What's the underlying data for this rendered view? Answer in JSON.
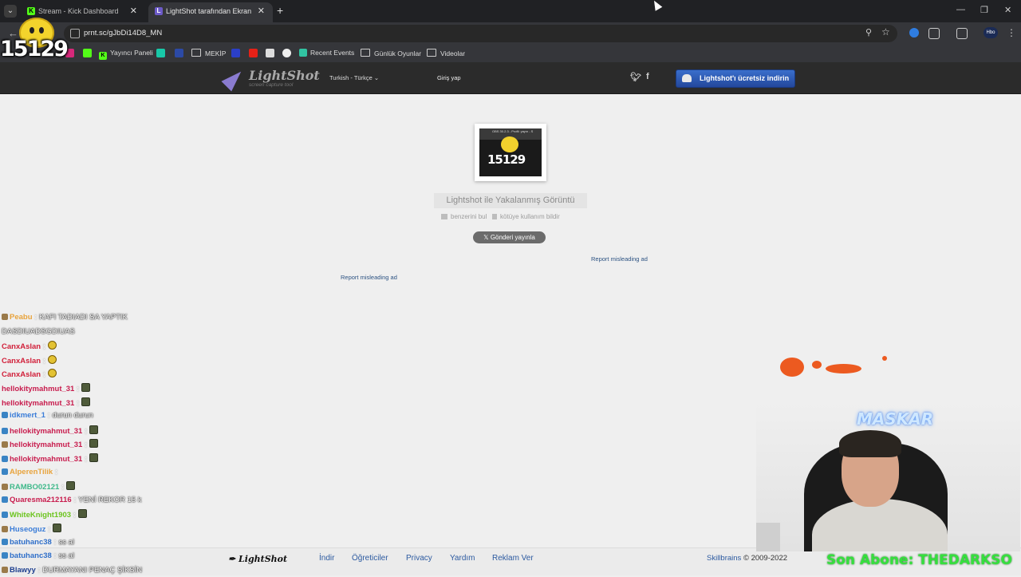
{
  "browser": {
    "tabs": [
      {
        "title": "Stream - Kick Dashboard",
        "active": false,
        "favicon": "kick-icon"
      },
      {
        "title": "LightShot tarafından Ekran Gör",
        "active": true,
        "favicon": "lightshot-icon"
      }
    ],
    "url": "prnt.sc/gJbDi14D8_MN",
    "bookmarks": [
      "Yayıncı Paneli",
      "MEKİP",
      "Recent Events",
      "Günlük Oyunlar",
      "Videolar"
    ],
    "profile_label": "Hbo"
  },
  "lightshot": {
    "logo": {
      "name": "LightShot",
      "tagline": "screen capture tool"
    },
    "language": "Turkish - Türkçe",
    "login": "Giriş yap",
    "social": {
      "twitter": "t",
      "facebook": "f"
    },
    "download_button": "Lightshot'ı ücretsiz indirin",
    "thumbnail": {
      "header_text": "OBS 30.2.3 - Profil: yayın - S",
      "number": "15129"
    },
    "capture_title": "Lightshot ile Yakalanmış Görüntü",
    "find_similar": "benzerini bul",
    "report_abuse": "kötüye kullanım bildir",
    "tweet_button": "Gönderi yayınla",
    "report_ad_1": "Report misleading ad",
    "report_ad_2": "Report misleading ad",
    "footer": {
      "logo": "LightShot",
      "links": [
        "İndir",
        "Öğreticiler",
        "Privacy",
        "Yardım",
        "Reklam Ver"
      ],
      "company": "Skillbrains",
      "copyright": "© 2009-2022"
    }
  },
  "overlay": {
    "counter": "15129",
    "webcam_name": "MASKAR",
    "last_subscriber": "Son Abone: THEDARKSO",
    "chat": [
      {
        "user": "Peabu",
        "text": "KAFI TADIADI SA YAPTIK",
        "color": "#e8a33c"
      },
      {
        "user": "",
        "text": "DASDIUADSGDIUAS",
        "color": "#ffffff"
      },
      {
        "user": "CanxAslan",
        "text": "",
        "color": "#d1203a",
        "emote": "face"
      },
      {
        "user": "CanxAslan",
        "text": "",
        "color": "#d1203a",
        "emote": "face"
      },
      {
        "user": "CanxAslan",
        "text": "",
        "color": "#d1203a",
        "emote": "face"
      },
      {
        "user": "hellokitymahmut_31",
        "text": "",
        "color": "#c81d4e",
        "emote": "tank"
      },
      {
        "user": "hellokitymahmut_31",
        "text": "",
        "color": "#c81d4e",
        "emote": "tank"
      },
      {
        "user": "idkmert_1",
        "text": "durun durun",
        "color": "#3b7dd8"
      },
      {
        "user": "hellokitymahmut_31",
        "text": "",
        "color": "#c81d4e",
        "emote": "tank"
      },
      {
        "user": "hellokitymahmut_31",
        "text": "",
        "color": "#c81d4e",
        "emote": "tank"
      },
      {
        "user": "hellokitymahmut_31",
        "text": "",
        "color": "#c81d4e",
        "emote": "tank"
      },
      {
        "user": "AlperenTilik",
        "text": "",
        "color": "#e8a33c"
      },
      {
        "user": "RAMBO02121",
        "text": "",
        "color": "#3fb98a",
        "emote": "tank"
      },
      {
        "user": "Quaresma212116",
        "text": "YENİ REKOR 15 k",
        "color": "#c81d4e"
      },
      {
        "user": "WhiteKnight1903",
        "text": "",
        "color": "#6cc41f",
        "emote": "tank"
      },
      {
        "user": "Huseoguz",
        "text": "",
        "color": "#3b7dd8",
        "emote": "tank"
      },
      {
        "user": "batuhanc38",
        "text": "ss al",
        "color": "#2f6fc9"
      },
      {
        "user": "batuhanc38",
        "text": "ss al",
        "color": "#2f6fc9"
      },
      {
        "user": "Blawyy",
        "text": "DURMAYANI PENAÇ ŞİKSİN",
        "color": "#1e3f8f"
      }
    ]
  }
}
